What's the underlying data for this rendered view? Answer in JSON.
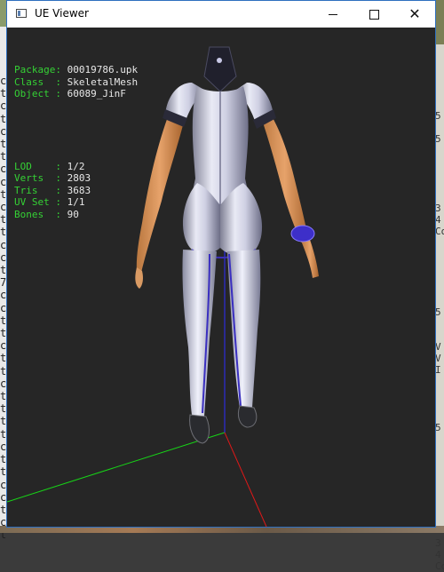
{
  "window": {
    "title": "UE Viewer"
  },
  "info_block_1": [
    {
      "key": "Package",
      "sep": ": ",
      "value": "00019786.upk"
    },
    {
      "key": "Class  ",
      "sep": ": ",
      "value": "SkeletalMesh"
    },
    {
      "key": "Object ",
      "sep": ": ",
      "value": "60089_JinF"
    }
  ],
  "info_block_2": [
    {
      "key": "LOD    ",
      "sep": ": ",
      "value": "1/2"
    },
    {
      "key": "Verts  ",
      "sep": ": ",
      "value": "2803"
    },
    {
      "key": "Tris   ",
      "sep": ": ",
      "value": "3683"
    },
    {
      "key": "UV Set ",
      "sep": ": ",
      "value": "1/1"
    },
    {
      "key": "Bones  ",
      "sep": ": ",
      "value": "90"
    }
  ],
  "colors": {
    "label": "#35d135",
    "value": "#e8e8e8",
    "viewport_bg": "#262626",
    "axis_x": "#e01818",
    "axis_y": "#17d417",
    "axis_z": "#2f2fff"
  },
  "icons": {
    "app": "window-icon",
    "minimize": "minimize-icon",
    "maximize": "maximize-icon",
    "close": "close-icon"
  },
  "background_left_text": "c\nt\nc\nt\nc\nt\nt\nc\nc\nt\nc\nt\nt\nc\nc\nt\n7\nc\nc\nt\nt\nc\nt\nt\nc\nt\nt\nt\nt\nc\nt\nt\nc\nc\nt\nc\nt",
  "background_right_text": "\n\n\n\n5\n\n5\n\n\n\n\n\n3\n4\nCo\n\n\n\n\n\n\n5\n\n\nV\nV\nI\n\n\n\n\n5\n\n\n\n\n\n\n\n\n\n3\n4\nCo"
}
